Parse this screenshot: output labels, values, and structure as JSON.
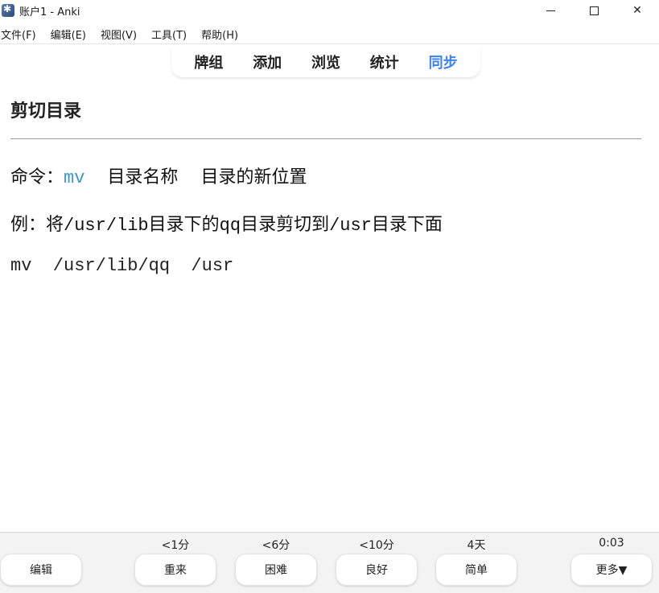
{
  "window": {
    "title": "账户1 - Anki"
  },
  "menu": [
    "文件(F)",
    "编辑(E)",
    "视图(V)",
    "工具(T)",
    "帮助(H)"
  ],
  "toolbar": {
    "decks": "牌组",
    "add": "添加",
    "browse": "浏览",
    "stats": "统计",
    "sync": "同步"
  },
  "card": {
    "title": "剪切目录",
    "line1": {
      "prefix": "命令：",
      "cmd": "mv",
      "arg1": "目录名称",
      "arg2": "目录的新位置"
    },
    "line2": {
      "p1": "例：将",
      "p2": "/usr/lib",
      "p3": "目录下的",
      "p4": "qq",
      "p5": "目录剪切到",
      "p6": "/usr",
      "p7": "目录下面"
    },
    "line3": "mv  /usr/lib/qq  /usr"
  },
  "bottom": {
    "edit": "编辑",
    "again_time": "<1分",
    "again": "重来",
    "hard_time": "<6分",
    "hard": "困难",
    "good_time": "<10分",
    "good": "良好",
    "easy_time": "4天",
    "easy": "简单",
    "timer": "0:03",
    "more": "更多▼"
  },
  "colors": {
    "sync_accent": "#3b82f6",
    "command_blue": "#3d97c9"
  }
}
